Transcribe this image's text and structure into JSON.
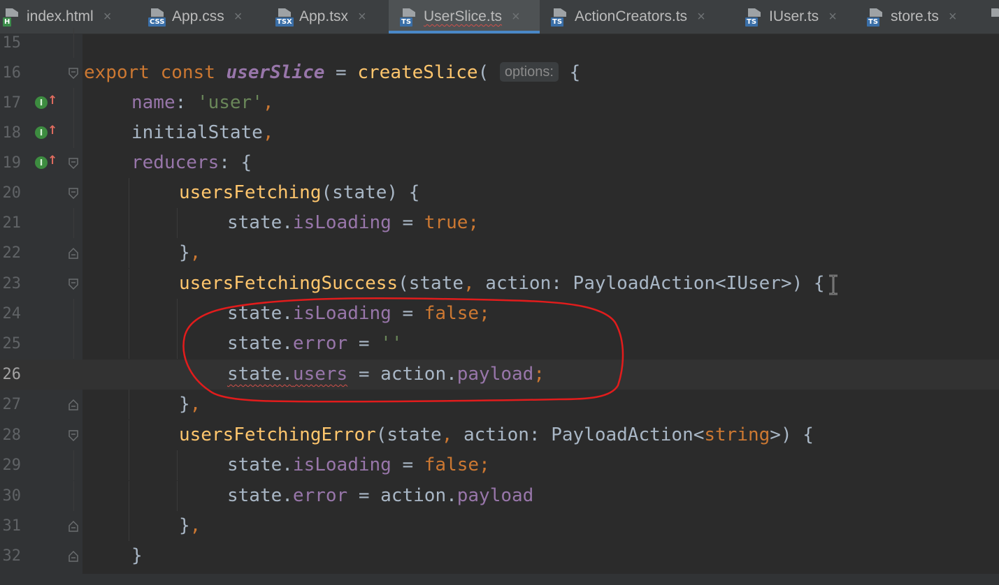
{
  "tabs": [
    {
      "label": "index.html",
      "icon": "html-file-icon",
      "badge": "H",
      "badge_color": "#3b8c4a"
    },
    {
      "label": "App.css",
      "icon": "css-file-icon",
      "badge": "CSS",
      "badge_color": "#3a6fa8"
    },
    {
      "label": "App.tsx",
      "icon": "tsx-file-icon",
      "badge": "TSX",
      "badge_color": "#3a6fa8"
    },
    {
      "label": "UserSlice.ts",
      "icon": "ts-file-icon",
      "badge": "TS",
      "badge_color": "#3a6fa8",
      "active": true
    },
    {
      "label": "ActionCreators.ts",
      "icon": "ts-file-icon",
      "badge": "TS",
      "badge_color": "#3a6fa8"
    },
    {
      "label": "IUser.ts",
      "icon": "ts-file-icon",
      "badge": "TS",
      "badge_color": "#3a6fa8"
    },
    {
      "label": "store.ts",
      "icon": "ts-file-icon",
      "badge": "TS",
      "badge_color": "#3a6fa8"
    }
  ],
  "tab_close_glyph": "×",
  "editor": {
    "line_numbers": [
      "15",
      "16",
      "17",
      "18",
      "19",
      "20",
      "21",
      "22",
      "23",
      "24",
      "25",
      "26",
      "27",
      "28",
      "29",
      "30",
      "31",
      "32"
    ],
    "current_line": "26",
    "lines": {
      "l16": {
        "kw_export": "export",
        "kw_const": "const",
        "name": "userSlice",
        "eq": " = ",
        "fn": "createSlice",
        "open": "(",
        "hint": "options:",
        "brace": "{"
      },
      "l17": {
        "prop": "name",
        "colon": ": ",
        "str": "'user'",
        "comma": ","
      },
      "l18": {
        "text": "initialState",
        "comma": ","
      },
      "l19": {
        "prop": "reducers",
        "rest": ": {"
      },
      "l20": {
        "fn": "usersFetching",
        "rest": "(state) {"
      },
      "l21": {
        "obj": "state.",
        "prop": "isLoading",
        "eq": " = ",
        "val": "true",
        "semi": ";"
      },
      "l22": {
        "text": "}",
        "comma": ","
      },
      "l23": {
        "fn": "usersFetchingSuccess",
        "rest": "(state",
        "comma": ",",
        "rest2": " action: PayloadAction<IUser>) {"
      },
      "l24": {
        "obj": "state.",
        "prop": "isLoading",
        "eq": " = ",
        "val": "false",
        "semi": ";"
      },
      "l25": {
        "obj": "state.",
        "prop": "error",
        "eq": " = ",
        "str": "''"
      },
      "l26": {
        "obj": "state.",
        "prop": "users",
        "eq": " = ",
        "obj2": "action.",
        "prop2": "payload",
        "semi": ";"
      },
      "l27": {
        "text": "}",
        "comma": ","
      },
      "l28": {
        "fn": "usersFetchingError",
        "rest": "(state",
        "comma": ",",
        "rest2": " action: PayloadAction<",
        "type": "string",
        "rest3": ">) {"
      },
      "l29": {
        "obj": "state.",
        "prop": "isLoading",
        "eq": " = ",
        "val": "false",
        "semi": ";"
      },
      "l30": {
        "obj": "state.",
        "prop": "error",
        "eq": " = ",
        "obj2": "action.",
        "prop2": "payload"
      },
      "l31": {
        "text": "}",
        "comma": ","
      },
      "l32": {
        "text": "}"
      }
    }
  },
  "colors": {
    "background": "#2b2b2b",
    "keyword": "#cc7832",
    "function": "#ffc66d",
    "property": "#9876aa",
    "string": "#6a8759",
    "text": "#a9b7c6",
    "annotation": "#e21c1c",
    "active_tab_underline": "#4a88c7"
  },
  "annotation": {
    "shape": "hand-drawn-ellipse",
    "color": "#e21c1c",
    "covers_lines": [
      "24",
      "25",
      "26"
    ]
  }
}
